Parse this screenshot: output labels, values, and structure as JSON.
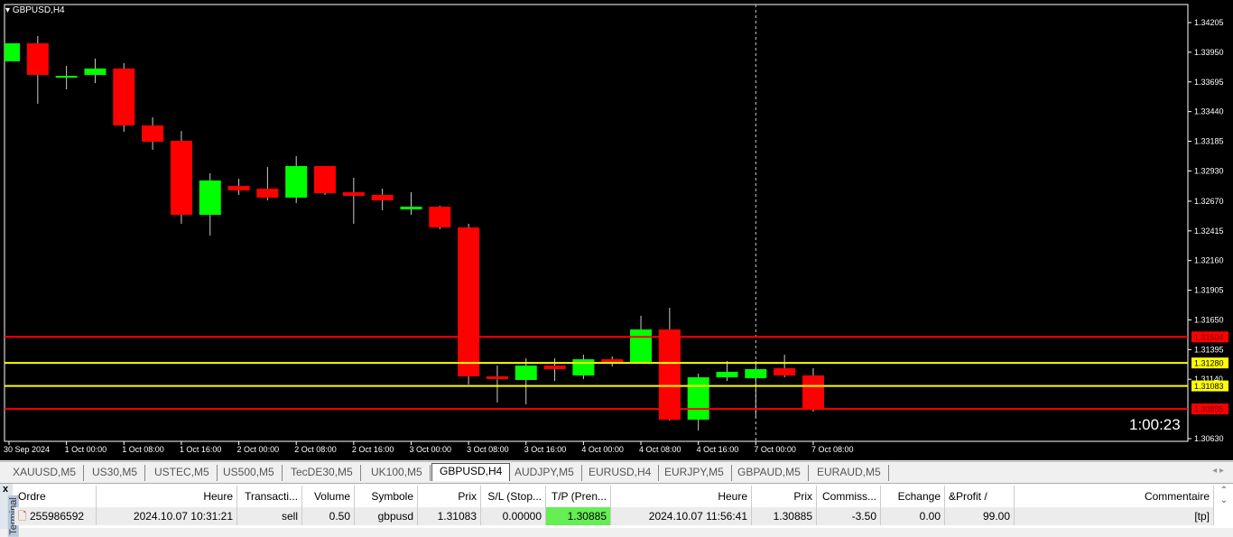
{
  "chart": {
    "title": "GBPUSD,H4",
    "timer": "1:00:23",
    "price_ticks": [
      "1.34205",
      "1.33950",
      "1.33695",
      "1.33440",
      "1.33185",
      "1.32930",
      "1.32670",
      "1.32415",
      "1.32160",
      "1.31905",
      "1.31650",
      "1.31395",
      "1.31140",
      "1.30630"
    ],
    "price_range": [
      1.3063,
      1.34205
    ],
    "levels": [
      {
        "price": "1.31504",
        "color": "#ff0000"
      },
      {
        "price": "1.31280",
        "color": "#ffff00"
      },
      {
        "price": "1.31083",
        "color": "#ffff00"
      },
      {
        "price": "1.30885",
        "color": "#ff0000"
      }
    ],
    "time_labels": [
      "30 Sep 2024",
      "1 Oct 00:00",
      "1 Oct 08:00",
      "1 Oct 16:00",
      "2 Oct 00:00",
      "2 Oct 08:00",
      "2 Oct 16:00",
      "3 Oct 00:00",
      "3 Oct 08:00",
      "3 Oct 16:00",
      "4 Oct 00:00",
      "4 Oct 08:00",
      "4 Oct 16:00",
      "7 Oct 00:00",
      "7 Oct 08:00"
    ],
    "crosshair_candle": 26,
    "colors": {
      "bull": "#00ff00",
      "bear": "#ff0000"
    },
    "candles": [
      [
        1.33872,
        1.34027,
        1.33872,
        1.34027
      ],
      [
        1.34027,
        1.34089,
        1.33507,
        1.33755
      ],
      [
        1.33732,
        1.33833,
        1.33631,
        1.33747
      ],
      [
        1.33755,
        1.33895,
        1.33685,
        1.3381
      ],
      [
        1.3381,
        1.33856,
        1.33267,
        1.33321
      ],
      [
        1.33321,
        1.33391,
        1.33112,
        1.33181
      ],
      [
        1.33189,
        1.33274,
        1.32476,
        1.32553
      ],
      [
        1.32553,
        1.3291,
        1.32375,
        1.32848
      ],
      [
        1.32801,
        1.32863,
        1.32724,
        1.32763
      ],
      [
        1.32778,
        1.32964,
        1.32677,
        1.32701
      ],
      [
        1.32701,
        1.33057,
        1.32654,
        1.32972
      ],
      [
        1.32972,
        1.32972,
        1.32724,
        1.32739
      ],
      [
        1.32747,
        1.32871,
        1.32476,
        1.32716
      ],
      [
        1.32724,
        1.32778,
        1.32592,
        1.32677
      ],
      [
        1.326,
        1.32747,
        1.32553,
        1.32623
      ],
      [
        1.32623,
        1.32631,
        1.32429,
        1.32445
      ],
      [
        1.32445,
        1.32476,
        1.31095,
        1.31165
      ],
      [
        1.31165,
        1.31258,
        1.3094,
        1.31142
      ],
      [
        1.31134,
        1.3132,
        1.30925,
        1.31258
      ],
      [
        1.31258,
        1.3132,
        1.31126,
        1.31227
      ],
      [
        1.31173,
        1.31351,
        1.31142,
        1.31312
      ],
      [
        1.31312,
        1.31336,
        1.3125,
        1.31274
      ],
      [
        1.31281,
        1.31685,
        1.31274,
        1.31568
      ],
      [
        1.31568,
        1.31754,
        1.30785,
        1.30793
      ],
      [
        1.30793,
        1.31188,
        1.307,
        1.31157
      ],
      [
        1.31157,
        1.31297,
        1.31126,
        1.31204
      ],
      [
        1.31149,
        1.31297,
        1.30816,
        1.31227
      ],
      [
        1.31235,
        1.31351,
        1.31157,
        1.31173
      ],
      [
        1.31173,
        1.31235,
        1.30863,
        1.30886
      ]
    ]
  },
  "tabs": [
    "XAUUSD,M5",
    "US30,M5",
    "USTEC,M5",
    "US500,M5",
    "TecDE30,M5",
    "UK100,M5",
    "GBPUSD,H4",
    "AUDJPY,M5",
    "EURUSD,H4",
    "EURJPY,M5",
    "GBPAUD,M5",
    "EURAUD,M5"
  ],
  "active_tab": 6,
  "terminal": {
    "close": "x",
    "label": "Terminal",
    "headers": [
      "Ordre",
      "Heure",
      "Transacti...",
      "Volume",
      "Symbole",
      "Prix",
      "S/L (Stop...",
      "T/P (Pren...",
      "Heure",
      "Prix",
      "Commiss...",
      "Echange",
      "&Profit",
      "Commentaire"
    ],
    "sort_mark": "/",
    "row": [
      "255986592",
      "2024.10.07 10:31:21",
      "sell",
      "0.50",
      "gbpusd",
      "1.31083",
      "0.00000",
      "1.30885",
      "2024.10.07 11:56:41",
      "1.30885",
      "-3.50",
      "0.00",
      "99.00",
      "[tp]"
    ]
  }
}
